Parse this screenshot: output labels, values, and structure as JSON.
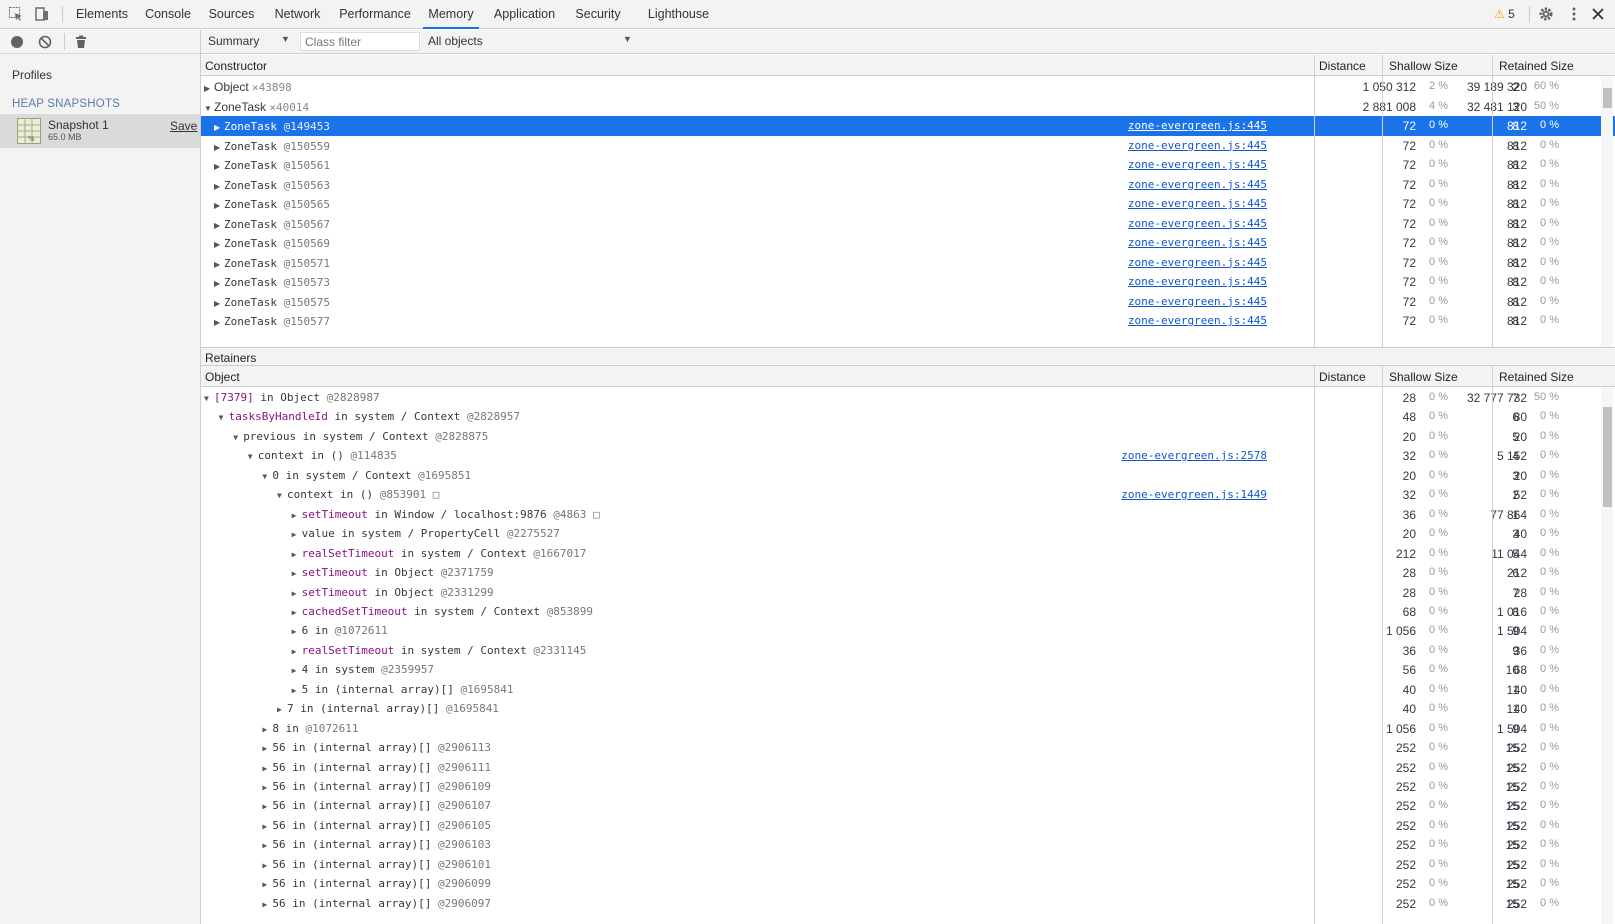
{
  "tabs": [
    "Elements",
    "Console",
    "Sources",
    "Network",
    "Performance",
    "Memory",
    "Application",
    "Security",
    "Lighthouse"
  ],
  "active_tab": "Memory",
  "warnings_count": "5",
  "sidebar": {
    "profiles_title": "Profiles",
    "heap_title": "HEAP SNAPSHOTS",
    "snapshot_name": "Snapshot 1",
    "snapshot_size": "65.0 MB",
    "save_label": "Save"
  },
  "toolbar": {
    "view": "Summary",
    "class_filter_placeholder": "Class filter",
    "objects": "All objects"
  },
  "constructors": {
    "headers": {
      "name": "Constructor",
      "distance": "Distance",
      "shallow": "Shallow Size",
      "retained": "Retained Size"
    },
    "rows": [
      {
        "indent": 0,
        "expanded": false,
        "name": "Object",
        "count": "×43898",
        "link": "",
        "distance": "2",
        "shallow": "1 050 312",
        "shallow_pct": "2 %",
        "retained": "39 189 320",
        "retained_pct": "60 %",
        "selected": false
      },
      {
        "indent": 0,
        "expanded": true,
        "name": "ZoneTask",
        "count": "×40014",
        "link": "",
        "distance": "3",
        "shallow": "2 881 008",
        "shallow_pct": "4 %",
        "retained": "32 481 120",
        "retained_pct": "50 %",
        "selected": false
      },
      {
        "indent": 1,
        "expanded": false,
        "name": "ZoneTask",
        "id": "@149453",
        "link": "zone-evergreen.js:445",
        "distance": "8",
        "shallow": "72",
        "shallow_pct": "0 %",
        "retained": "812",
        "retained_pct": "0 %",
        "selected": true
      },
      {
        "indent": 1,
        "expanded": false,
        "name": "ZoneTask",
        "id": "@150559",
        "link": "zone-evergreen.js:445",
        "distance": "8",
        "shallow": "72",
        "shallow_pct": "0 %",
        "retained": "812",
        "retained_pct": "0 %",
        "selected": false
      },
      {
        "indent": 1,
        "expanded": false,
        "name": "ZoneTask",
        "id": "@150561",
        "link": "zone-evergreen.js:445",
        "distance": "8",
        "shallow": "72",
        "shallow_pct": "0 %",
        "retained": "812",
        "retained_pct": "0 %",
        "selected": false
      },
      {
        "indent": 1,
        "expanded": false,
        "name": "ZoneTask",
        "id": "@150563",
        "link": "zone-evergreen.js:445",
        "distance": "8",
        "shallow": "72",
        "shallow_pct": "0 %",
        "retained": "812",
        "retained_pct": "0 %",
        "selected": false
      },
      {
        "indent": 1,
        "expanded": false,
        "name": "ZoneTask",
        "id": "@150565",
        "link": "zone-evergreen.js:445",
        "distance": "8",
        "shallow": "72",
        "shallow_pct": "0 %",
        "retained": "812",
        "retained_pct": "0 %",
        "selected": false
      },
      {
        "indent": 1,
        "expanded": false,
        "name": "ZoneTask",
        "id": "@150567",
        "link": "zone-evergreen.js:445",
        "distance": "8",
        "shallow": "72",
        "shallow_pct": "0 %",
        "retained": "812",
        "retained_pct": "0 %",
        "selected": false
      },
      {
        "indent": 1,
        "expanded": false,
        "name": "ZoneTask",
        "id": "@150569",
        "link": "zone-evergreen.js:445",
        "distance": "8",
        "shallow": "72",
        "shallow_pct": "0 %",
        "retained": "812",
        "retained_pct": "0 %",
        "selected": false
      },
      {
        "indent": 1,
        "expanded": false,
        "name": "ZoneTask",
        "id": "@150571",
        "link": "zone-evergreen.js:445",
        "distance": "8",
        "shallow": "72",
        "shallow_pct": "0 %",
        "retained": "812",
        "retained_pct": "0 %",
        "selected": false
      },
      {
        "indent": 1,
        "expanded": false,
        "name": "ZoneTask",
        "id": "@150573",
        "link": "zone-evergreen.js:445",
        "distance": "8",
        "shallow": "72",
        "shallow_pct": "0 %",
        "retained": "812",
        "retained_pct": "0 %",
        "selected": false
      },
      {
        "indent": 1,
        "expanded": false,
        "name": "ZoneTask",
        "id": "@150575",
        "link": "zone-evergreen.js:445",
        "distance": "8",
        "shallow": "72",
        "shallow_pct": "0 %",
        "retained": "812",
        "retained_pct": "0 %",
        "selected": false
      },
      {
        "indent": 1,
        "expanded": false,
        "name": "ZoneTask",
        "id": "@150577",
        "link": "zone-evergreen.js:445",
        "distance": "8",
        "shallow": "72",
        "shallow_pct": "0 %",
        "retained": "812",
        "retained_pct": "0 %",
        "selected": false
      }
    ]
  },
  "retainers": {
    "title": "Retainers",
    "headers": {
      "name": "Object",
      "distance": "Distance",
      "shallow": "Shallow Size",
      "retained": "Retained Size"
    },
    "rows": [
      {
        "indent": 0,
        "expanded": true,
        "prop": "[7379]",
        "mid": " in Object ",
        "id": "@2828987",
        "link": "",
        "distance": "7",
        "shallow": "28",
        "shallow_pct": "0 %",
        "retained": "32 777 732",
        "retained_pct": "50 %"
      },
      {
        "indent": 1,
        "expanded": true,
        "prop": "tasksByHandleId",
        "mid": " in system / Context ",
        "id": "@2828957",
        "link": "",
        "distance": "6",
        "shallow": "48",
        "shallow_pct": "0 %",
        "retained": "80",
        "retained_pct": "0 %"
      },
      {
        "indent": 2,
        "expanded": true,
        "prop": "previous",
        "plain": true,
        "mid": " in system / Context ",
        "id": "@2828875",
        "link": "",
        "distance": "5",
        "shallow": "20",
        "shallow_pct": "0 %",
        "retained": "20",
        "retained_pct": "0 %"
      },
      {
        "indent": 3,
        "expanded": true,
        "prop": "context",
        "plain": true,
        "mid": " in () ",
        "id": "@114835",
        "link": "zone-evergreen.js:2578",
        "distance": "4",
        "shallow": "32",
        "shallow_pct": "0 %",
        "retained": "5 152",
        "retained_pct": "0 %"
      },
      {
        "indent": 4,
        "expanded": true,
        "prop": "0",
        "plain": true,
        "mid": " in system / Context ",
        "id": "@1695851",
        "link": "",
        "distance": "3",
        "shallow": "20",
        "shallow_pct": "0 %",
        "retained": "20",
        "retained_pct": "0 %"
      },
      {
        "indent": 5,
        "expanded": true,
        "prop": "context",
        "plain": true,
        "mid": " in () ",
        "id": "@853901 □",
        "link": "zone-evergreen.js:1449",
        "distance": "2",
        "shallow": "32",
        "shallow_pct": "0 %",
        "retained": "52",
        "retained_pct": "0 %"
      },
      {
        "indent": 6,
        "expanded": false,
        "prop": "setTimeout",
        "mid": " in Window / localhost:9876 ",
        "id": "@4863 □",
        "link": "",
        "distance": "1",
        "shallow": "36",
        "shallow_pct": "0 %",
        "retained": "77 864",
        "retained_pct": "0 %"
      },
      {
        "indent": 6,
        "expanded": false,
        "prop": "value",
        "plain": true,
        "mid": " in system / PropertyCell ",
        "id": "@2275527",
        "link": "",
        "distance": "3",
        "shallow": "20",
        "shallow_pct": "0 %",
        "retained": "40",
        "retained_pct": "0 %"
      },
      {
        "indent": 6,
        "expanded": false,
        "prop": "realSetTimeout",
        "mid": " in system / Context ",
        "id": "@1667017",
        "link": "",
        "distance": "5",
        "shallow": "212",
        "shallow_pct": "0 %",
        "retained": "11 044",
        "retained_pct": "0 %"
      },
      {
        "indent": 6,
        "expanded": false,
        "prop": "setTimeout",
        "mid": " in Object ",
        "id": "@2371759",
        "link": "",
        "distance": "6",
        "shallow": "28",
        "shallow_pct": "0 %",
        "retained": "212",
        "retained_pct": "0 %"
      },
      {
        "indent": 6,
        "expanded": false,
        "prop": "setTimeout",
        "mid": " in Object ",
        "id": "@2331299",
        "link": "",
        "distance": "7",
        "shallow": "28",
        "shallow_pct": "0 %",
        "retained": "28",
        "retained_pct": "0 %"
      },
      {
        "indent": 6,
        "expanded": false,
        "prop": "cachedSetTimeout",
        "mid": " in system / Context ",
        "id": "@853899",
        "link": "",
        "distance": "8",
        "shallow": "68",
        "shallow_pct": "0 %",
        "retained": "1 016",
        "retained_pct": "0 %"
      },
      {
        "indent": 6,
        "expanded": false,
        "prop": "6",
        "plain": true,
        "mid": " in  ",
        "id": "@1072611",
        "link": "",
        "distance": "9",
        "shallow": "1 056",
        "shallow_pct": "0 %",
        "retained": "1 504",
        "retained_pct": "0 %"
      },
      {
        "indent": 6,
        "expanded": false,
        "prop": "realSetTimeout",
        "mid": " in system / Context ",
        "id": "@2331145",
        "link": "",
        "distance": "9",
        "shallow": "36",
        "shallow_pct": "0 %",
        "retained": "36",
        "retained_pct": "0 %"
      },
      {
        "indent": 6,
        "expanded": false,
        "prop": "4",
        "plain": true,
        "mid": " in system ",
        "id": "@2359957",
        "link": "",
        "distance": "10",
        "shallow": "56",
        "shallow_pct": "0 %",
        "retained": "68",
        "retained_pct": "0 %"
      },
      {
        "indent": 6,
        "expanded": false,
        "prop": "5",
        "plain": true,
        "mid": " in (internal array)[] ",
        "id": "@1695841",
        "link": "",
        "distance": "11",
        "shallow": "40",
        "shallow_pct": "0 %",
        "retained": "40",
        "retained_pct": "0 %"
      },
      {
        "indent": 5,
        "expanded": false,
        "prop": "7",
        "plain": true,
        "mid": " in (internal array)[] ",
        "id": "@1695841",
        "link": "",
        "distance": "11",
        "shallow": "40",
        "shallow_pct": "0 %",
        "retained": "40",
        "retained_pct": "0 %"
      },
      {
        "indent": 4,
        "expanded": false,
        "prop": "8",
        "plain": true,
        "mid": " in  ",
        "id": "@1072611",
        "link": "",
        "distance": "9",
        "shallow": "1 056",
        "shallow_pct": "0 %",
        "retained": "1 504",
        "retained_pct": "0 %"
      },
      {
        "indent": 4,
        "expanded": false,
        "prop": "56",
        "plain": true,
        "mid": " in (internal array)[] ",
        "id": "@2906113",
        "link": "",
        "distance": "15",
        "shallow": "252",
        "shallow_pct": "0 %",
        "retained": "252",
        "retained_pct": "0 %"
      },
      {
        "indent": 4,
        "expanded": false,
        "prop": "56",
        "plain": true,
        "mid": " in (internal array)[] ",
        "id": "@2906111",
        "link": "",
        "distance": "15",
        "shallow": "252",
        "shallow_pct": "0 %",
        "retained": "252",
        "retained_pct": "0 %"
      },
      {
        "indent": 4,
        "expanded": false,
        "prop": "56",
        "plain": true,
        "mid": " in (internal array)[] ",
        "id": "@2906109",
        "link": "",
        "distance": "15",
        "shallow": "252",
        "shallow_pct": "0 %",
        "retained": "252",
        "retained_pct": "0 %"
      },
      {
        "indent": 4,
        "expanded": false,
        "prop": "56",
        "plain": true,
        "mid": " in (internal array)[] ",
        "id": "@2906107",
        "link": "",
        "distance": "15",
        "shallow": "252",
        "shallow_pct": "0 %",
        "retained": "252",
        "retained_pct": "0 %"
      },
      {
        "indent": 4,
        "expanded": false,
        "prop": "56",
        "plain": true,
        "mid": " in (internal array)[] ",
        "id": "@2906105",
        "link": "",
        "distance": "15",
        "shallow": "252",
        "shallow_pct": "0 %",
        "retained": "252",
        "retained_pct": "0 %"
      },
      {
        "indent": 4,
        "expanded": false,
        "prop": "56",
        "plain": true,
        "mid": " in (internal array)[] ",
        "id": "@2906103",
        "link": "",
        "distance": "15",
        "shallow": "252",
        "shallow_pct": "0 %",
        "retained": "252",
        "retained_pct": "0 %"
      },
      {
        "indent": 4,
        "expanded": false,
        "prop": "56",
        "plain": true,
        "mid": " in (internal array)[] ",
        "id": "@2906101",
        "link": "",
        "distance": "15",
        "shallow": "252",
        "shallow_pct": "0 %",
        "retained": "252",
        "retained_pct": "0 %"
      },
      {
        "indent": 4,
        "expanded": false,
        "prop": "56",
        "plain": true,
        "mid": " in (internal array)[] ",
        "id": "@2906099",
        "link": "",
        "distance": "15",
        "shallow": "252",
        "shallow_pct": "0 %",
        "retained": "252",
        "retained_pct": "0 %"
      },
      {
        "indent": 4,
        "expanded": false,
        "prop": "56",
        "plain": true,
        "mid": " in (internal array)[] ",
        "id": "@2906097",
        "link": "",
        "distance": "15",
        "shallow": "252",
        "shallow_pct": "0 %",
        "retained": "252",
        "retained_pct": "0 %"
      }
    ]
  },
  "colors": {
    "accent": "#1a73e8",
    "link": "#1155cc",
    "property": "#881280",
    "warning": "#f2a600"
  }
}
